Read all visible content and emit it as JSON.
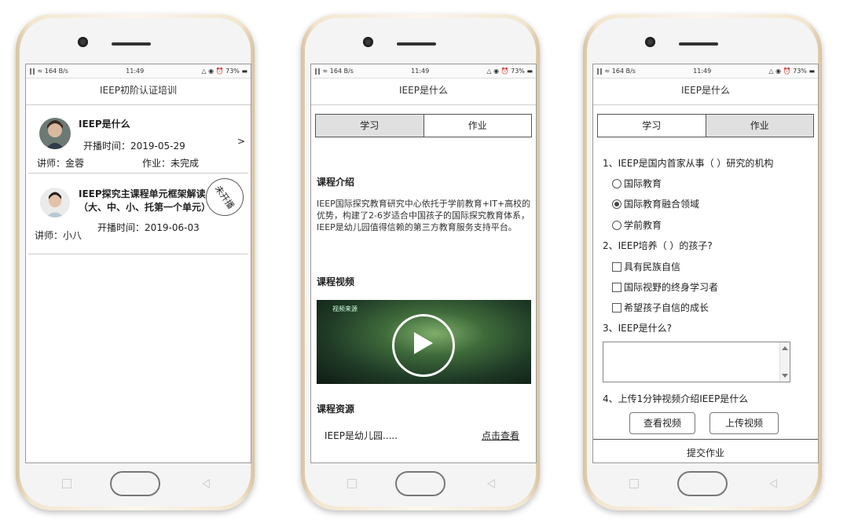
{
  "status": {
    "left": "‖‖ ≈ 164 B/s",
    "time": "11:49",
    "right": "△ ◉ ⏰ 73% ▬"
  },
  "phone1": {
    "title": "IEEP初阶认证培训",
    "courses": [
      {
        "title": "IEEP是什么",
        "time_label": "开播时间：2019-05-29",
        "teacher": "讲师：金蓉",
        "homework": "作业：未完成",
        "arrow": ">"
      },
      {
        "title_line1": "IEEP探究主课程单元框架解读",
        "title_line2": "（大、中、小、托第一个单元）",
        "time_label": "开播时间：2019-06-03",
        "teacher": "讲师：小八",
        "stamp": "未开播"
      }
    ]
  },
  "phone2": {
    "title": "IEEP是什么",
    "tabs": [
      "学习",
      "作业"
    ],
    "intro_title": "课程介绍",
    "intro_text": "IEEP国际探究教育研究中心依托于学前教育+IT+高校的优势，构建了2-6岁适合中国孩子的国际探究教育体系，IEEP是幼儿园值得信赖的第三方教育服务支持平台。",
    "video_title": "课程视频",
    "video_tag": "视频来源",
    "resource_title": "课程资源",
    "resource_name": "IEEP是幼儿园.....",
    "resource_link": "点击查看"
  },
  "phone3": {
    "title": "IEEP是什么",
    "tabs": [
      "学习",
      "作业"
    ],
    "q1": "1、IEEP是国内首家从事（   ）研究的机构",
    "q1_options": [
      "国际教育",
      "国际教育融合领域",
      "学前教育"
    ],
    "q1_selected": 1,
    "q2": "2、IEEP培养（   ）的孩子?",
    "q2_options": [
      "具有民族自信",
      "国际视野的终身学习者",
      "希望孩子自信的成长"
    ],
    "q3": "3、IEEP是什么?",
    "q4": "4、上传1分钟视频介绍IEEP是什么",
    "view_video": "查看视频",
    "upload_video": "上传视频",
    "submit": "提交作业"
  }
}
